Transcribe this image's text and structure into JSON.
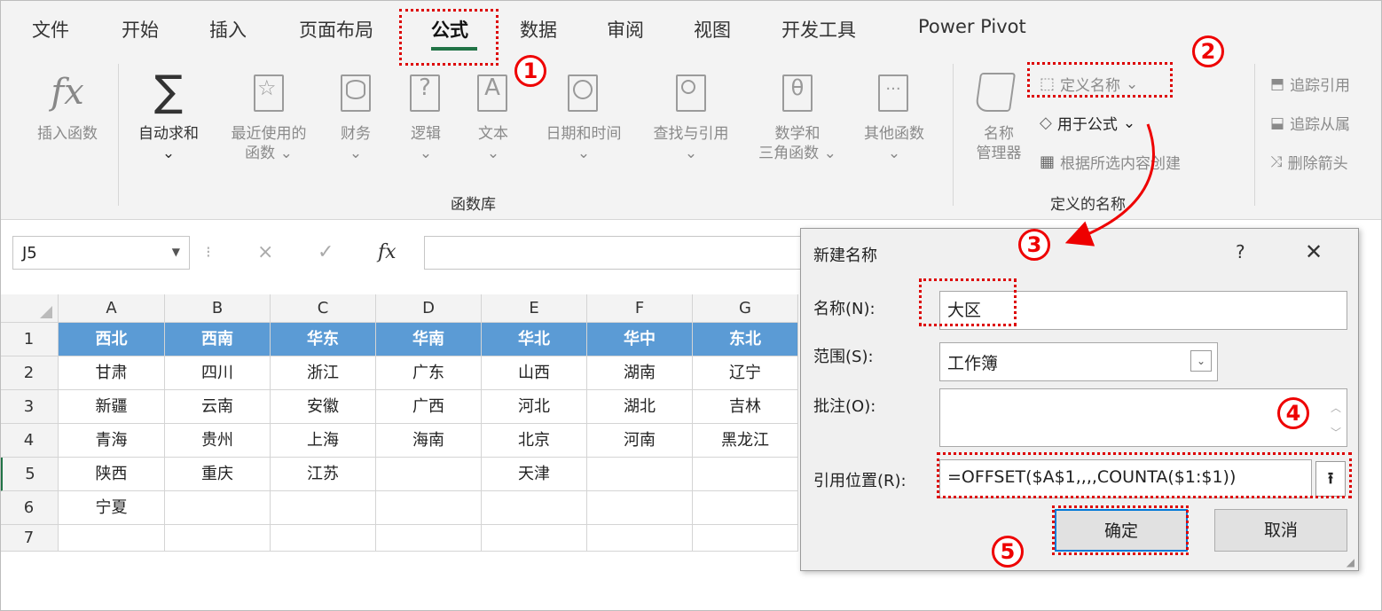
{
  "ribbon": {
    "tabs": [
      "文件",
      "开始",
      "插入",
      "页面布局",
      "公式",
      "数据",
      "审阅",
      "视图",
      "开发工具",
      "Power Pivot"
    ],
    "function_library": {
      "insert_function_glyph": "fx",
      "insert_function": "插入函数",
      "autosum_glyph": "∑",
      "autosum": "自动求和",
      "recent_line1": "最近使用的",
      "recent_line2": "函数",
      "finance": "财务",
      "logic_glyph": "?",
      "logic": "逻辑",
      "text_glyph": "A",
      "text": "文本",
      "datetime": "日期和时间",
      "lookup": "查找与引用",
      "math_glyph": "θ",
      "math_line1": "数学和",
      "math_line2": "三角函数",
      "other_glyph": "···",
      "other": "其他函数",
      "group_label": "函数库",
      "dropdown_glyph": "⌄"
    },
    "defined_names": {
      "name_manager_line1": "名称",
      "name_manager_line2": "管理器",
      "define_name": "定义名称",
      "use_in_formula": "用于公式",
      "create_from_selection": "根据所选内容创建",
      "group_label": "定义的名称"
    },
    "formula_auditing": {
      "trace_precedents": "追踪引用",
      "trace_dependents": "追踪从属",
      "remove_arrows": "删除箭头"
    }
  },
  "formula_bar": {
    "name_box": "J5",
    "fx_glyph": "fx",
    "cancel_glyph": "×",
    "enter_glyph": "✓",
    "sep_glyph": "⁝"
  },
  "sheet": {
    "columns": [
      "A",
      "B",
      "C",
      "D",
      "E",
      "F",
      "G"
    ],
    "rows": [
      "1",
      "2",
      "3",
      "4",
      "5",
      "6",
      "7"
    ],
    "header_row": [
      "西北",
      "西南",
      "华东",
      "华南",
      "华北",
      "华中",
      "东北"
    ],
    "data": [
      [
        "甘肃",
        "四川",
        "浙江",
        "广东",
        "山西",
        "湖南",
        "辽宁"
      ],
      [
        "新疆",
        "云南",
        "安徽",
        "广西",
        "河北",
        "湖北",
        "吉林"
      ],
      [
        "青海",
        "贵州",
        "上海",
        "海南",
        "北京",
        "河南",
        "黑龙江"
      ],
      [
        "陕西",
        "重庆",
        "江苏",
        "",
        "天津",
        "",
        ""
      ],
      [
        "宁夏",
        "",
        "",
        "",
        "",
        "",
        ""
      ]
    ],
    "header_color": "#5b9bd5"
  },
  "dialog": {
    "title": "新建名称",
    "help": "?",
    "close": "✕",
    "name_label": "名称(N):",
    "name_value": "大区",
    "scope_label": "范围(S):",
    "scope_value": "工作簿",
    "comment_label": "批注(O):",
    "ref_label": "引用位置(R):",
    "ref_value": "=OFFSET($A$1,,,,COUNTA($1:$1))",
    "ok": "确定",
    "cancel": "取消",
    "collapse_glyph": "⭱"
  },
  "annotations": {
    "step1": "1",
    "step2": "2",
    "step3": "3",
    "step4": "4",
    "step5": "5",
    "color": "#dd0000"
  }
}
